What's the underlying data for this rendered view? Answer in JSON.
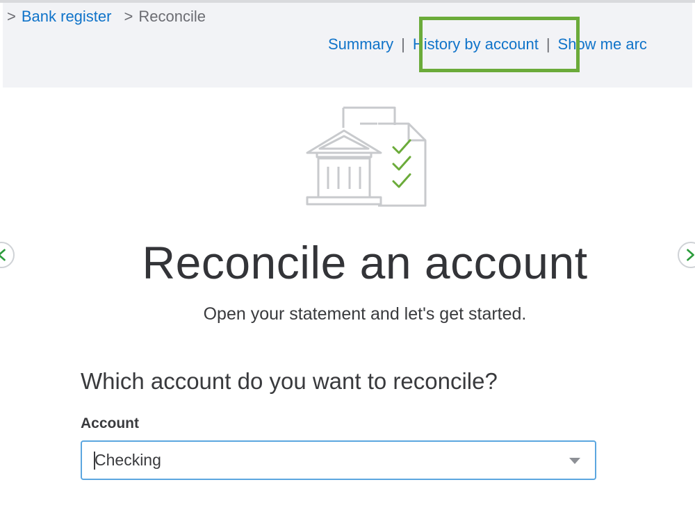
{
  "breadcrumb": {
    "sep1": ">",
    "bank_register": "Bank register",
    "sep2": ">",
    "current": "Reconcile"
  },
  "header_links": {
    "summary": "Summary",
    "divider": "|",
    "history_by_account": "History by account",
    "show_me_around": "Show me arc"
  },
  "colors": {
    "link": "#0f73c9",
    "highlight": "#6bab3a",
    "header_bg": "#f2f3f6",
    "focus_border": "#5ba6df"
  },
  "icons": {
    "illustration": "bank-statement-checklist-icon",
    "prev": "chevron-left-icon",
    "next": "chevron-right-icon",
    "dropdown": "caret-down-icon"
  },
  "main": {
    "title": "Reconcile an account",
    "subtitle": "Open your statement and let's get started.",
    "question": "Which account do you want to reconcile?",
    "account_label": "Account",
    "account_value": "Checking"
  }
}
